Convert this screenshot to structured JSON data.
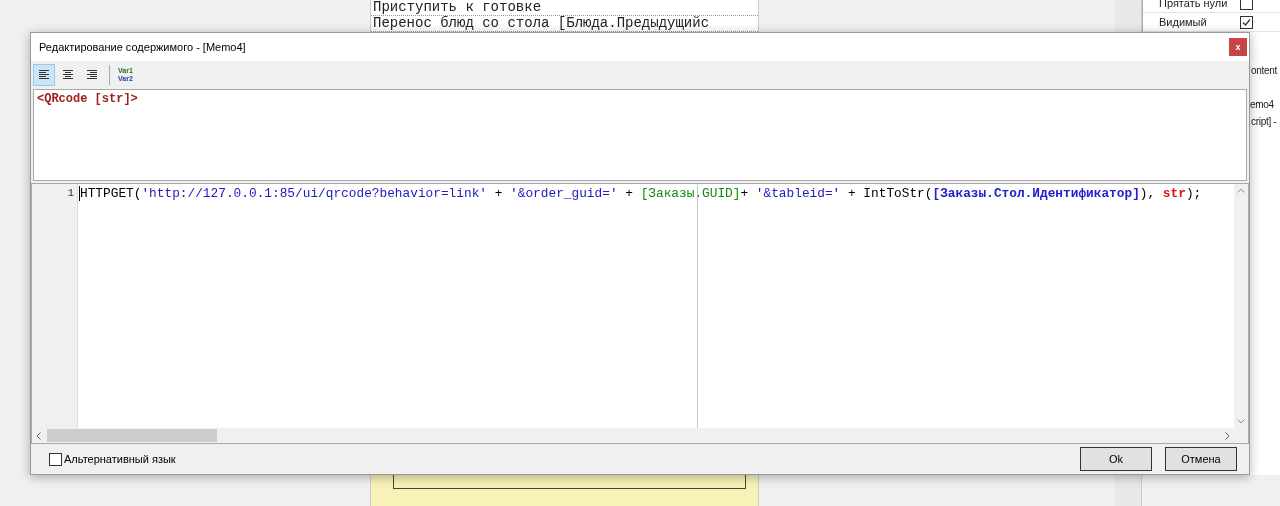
{
  "background": {
    "report_lines": [
      "Приступить к готовке",
      "Перенос блюд со стола [Блюда.Предыдущийс"
    ],
    "property_rows": [
      {
        "label": "Прятать нули",
        "checked": false
      },
      {
        "label": "Видимый",
        "checked": true
      }
    ],
    "fragments": [
      "ontent",
      "emo4",
      "cript] -"
    ]
  },
  "dialog": {
    "title": "Редактирование содержимого - [Memo4]",
    "close": "x",
    "align_buttons": [
      {
        "kind": "left",
        "selected": true
      },
      {
        "kind": "center",
        "selected": false
      },
      {
        "kind": "right",
        "selected": false
      }
    ],
    "var_button": [
      "Var1",
      "Var2"
    ],
    "memo_text": "<QRcode [str]>",
    "code": {
      "line_number": "1",
      "tokens": [
        {
          "text": "HTTPGET(",
          "kind": "plain"
        },
        {
          "text": "'http://127.0.0.1:85/ui/qrcode?behavior=link'",
          "kind": "string"
        },
        {
          "text": " + ",
          "kind": "plain"
        },
        {
          "text": "'&order_guid='",
          "kind": "string"
        },
        {
          "text": " + ",
          "kind": "plain"
        },
        {
          "text": "[Заказы.GUID]",
          "kind": "field"
        },
        {
          "text": "+ ",
          "kind": "plain"
        },
        {
          "text": "'&tableid='",
          "kind": "string"
        },
        {
          "text": " + IntToStr(",
          "kind": "plain"
        },
        {
          "text": "[Заказы.Стол.Идентификатор]",
          "kind": "variable"
        },
        {
          "text": "), ",
          "kind": "plain"
        },
        {
          "text": "str",
          "kind": "keyword"
        },
        {
          "text": ");",
          "kind": "plain"
        }
      ]
    },
    "alt_language": {
      "label": "Альтернативный язык",
      "checked": false
    },
    "buttons": [
      "Ok",
      "Отмена"
    ]
  }
}
